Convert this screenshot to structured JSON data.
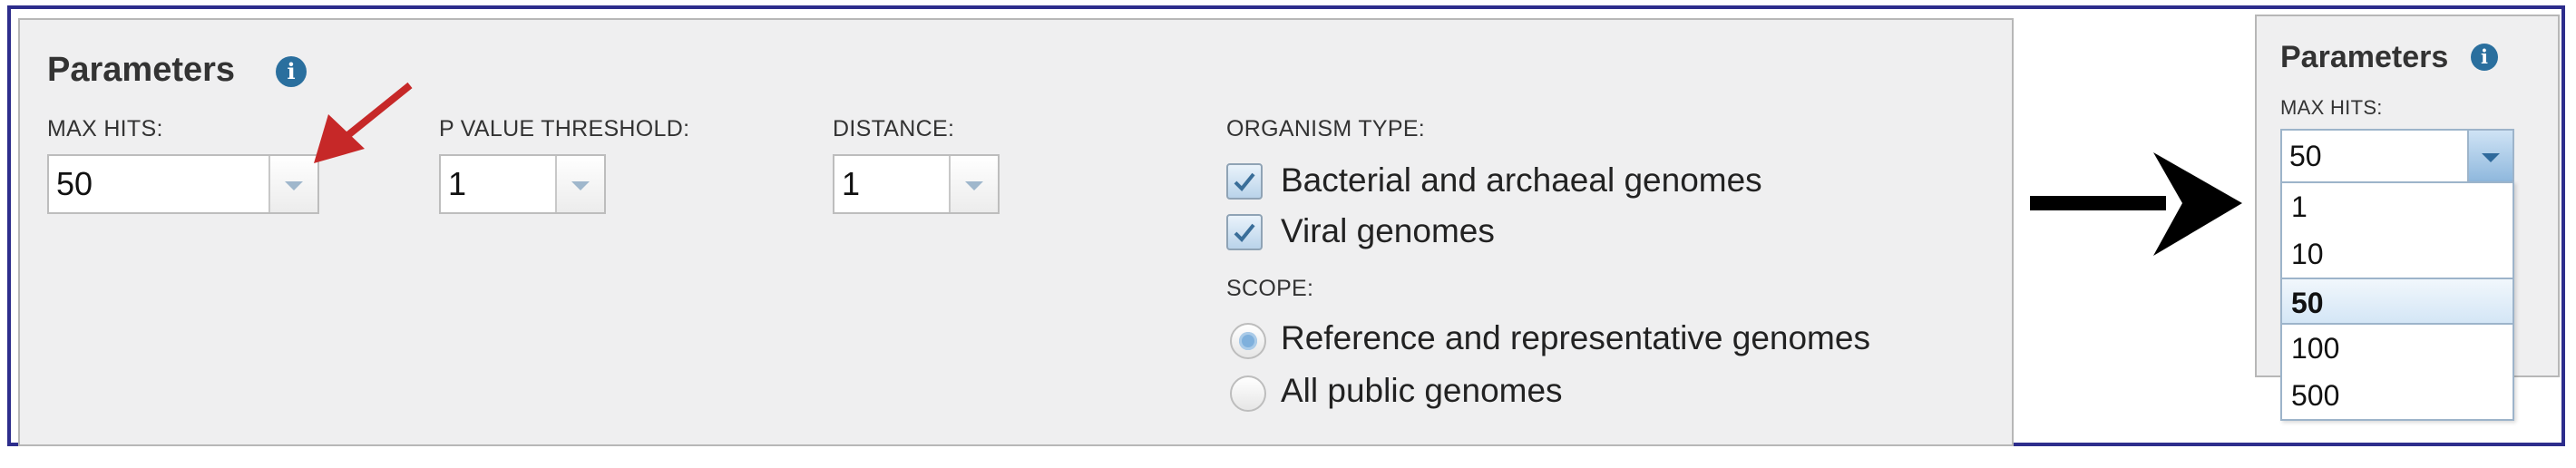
{
  "colors": {
    "frame": "#2d2d8c",
    "info_icon": "#2a6f9e",
    "red_arrow": "#c62828"
  },
  "parameters": {
    "title": "Parameters",
    "info_icon": "info-icon",
    "max_hits": {
      "label": "MAX HITS:",
      "value": "50"
    },
    "p_value": {
      "label": "P VALUE THRESHOLD:",
      "value": "1"
    },
    "distance": {
      "label": "DISTANCE:",
      "value": "1"
    },
    "organism_type": {
      "label": "ORGANISM TYPE:",
      "options": [
        {
          "label": "Bacterial and archaeal genomes",
          "checked": true
        },
        {
          "label": "Viral genomes",
          "checked": true
        }
      ]
    },
    "scope": {
      "label": "SCOPE:",
      "options": [
        {
          "label": "Reference and representative genomes",
          "selected": true
        },
        {
          "label": "All public genomes",
          "selected": false
        }
      ]
    }
  },
  "expanded": {
    "title": "Parameters",
    "max_hits_label": "MAX HITS:",
    "value": "50",
    "options": [
      "1",
      "10",
      "50",
      "100",
      "500"
    ],
    "selected": "50"
  }
}
